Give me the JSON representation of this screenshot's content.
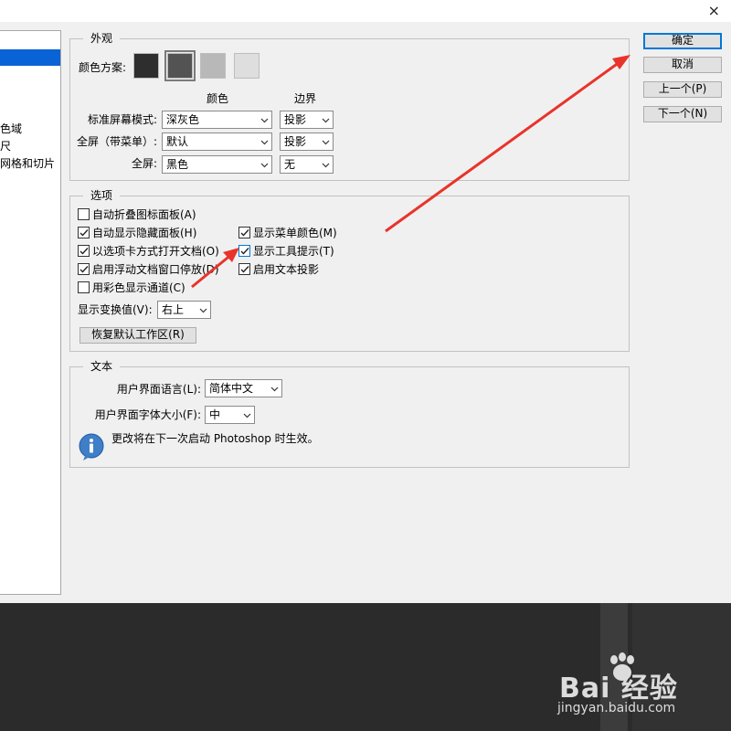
{
  "titlebar": {
    "close_glyph": "×"
  },
  "nav": {
    "items": [
      {
        "label": ""
      },
      {
        "label": ""
      },
      {
        "label": "色域"
      },
      {
        "label": "尺"
      },
      {
        "label": "网格和切片"
      }
    ]
  },
  "appearance": {
    "title": "外观",
    "color_scheme_label": "颜色方案:",
    "swatches": [
      "#2e2e2e",
      "#535353",
      "#b8b8b8",
      "#dedede"
    ],
    "selected_swatch_index": 1,
    "col_color": "颜色",
    "col_border": "边界",
    "rows": [
      {
        "label": "标准屏幕模式:",
        "color": "深灰色",
        "border": "投影"
      },
      {
        "label": "全屏（带菜单）:",
        "color": "默认",
        "border": "投影"
      },
      {
        "label": "全屏:",
        "color": "黑色",
        "border": "无"
      }
    ]
  },
  "options": {
    "title": "选项",
    "checkboxes": [
      {
        "label": "自动折叠图标面板(A)",
        "checked": false
      },
      {
        "label": "自动显示隐藏面板(H)",
        "checked": true
      },
      {
        "label": "以选项卡方式打开文档(O)",
        "checked": true
      },
      {
        "label": "启用浮动文档窗口停放(D)",
        "checked": true
      },
      {
        "label": "用彩色显示通道(C)",
        "checked": false
      },
      {
        "label": "显示菜单颜色(M)",
        "checked": true
      },
      {
        "label": "显示工具提示(T)",
        "checked": true
      },
      {
        "label": "启用文本投影",
        "checked": true
      }
    ],
    "transform_label": "显示变换值(V):",
    "transform_value": "右上",
    "restore_button": "恢复默认工作区(R)"
  },
  "text_section": {
    "title": "文本",
    "language_label": "用户界面语言(L):",
    "language_value": "简体中文",
    "font_size_label": "用户界面字体大小(F):",
    "font_size_value": "中",
    "info": "更改将在下一次启动 Photoshop 时生效。"
  },
  "buttons": {
    "ok": "确定",
    "cancel": "取消",
    "prev": "上一个(P)",
    "next": "下一个(N)"
  },
  "watermark": {
    "logo": "Bai  经验",
    "url": "jingyan.baidu.com"
  },
  "colors": {
    "accent": "#0a63d6",
    "arrow": "#e8342b",
    "dark": "#2b2b2b"
  }
}
